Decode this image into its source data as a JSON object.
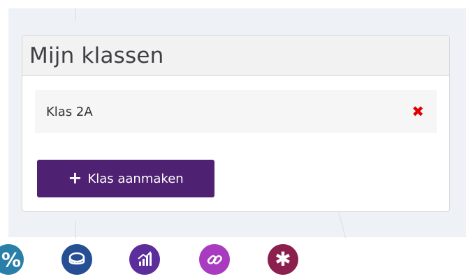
{
  "card": {
    "title": "Mijn klassen"
  },
  "classes": [
    {
      "name": "Klas 2A",
      "delete_icon": "close-icon"
    }
  ],
  "create_button": {
    "label": "Klas aanmaken",
    "icon": "plus-icon",
    "color": "#4f2173"
  },
  "bottom_icons": [
    {
      "name": "percent-icon",
      "glyph": "%",
      "color": "#2a7fa8"
    },
    {
      "name": "measuring-tape-icon",
      "glyph": "",
      "color": "#254f92"
    },
    {
      "name": "growth-chart-icon",
      "glyph": "",
      "color": "#5b2e9c"
    },
    {
      "name": "link-icon",
      "glyph": "",
      "color": "#a83bbf"
    },
    {
      "name": "asterisk-icon",
      "glyph": "✱",
      "color": "#8b1f4d"
    }
  ],
  "colors": {
    "delete": "#e00000",
    "background": "#eef2f6"
  }
}
